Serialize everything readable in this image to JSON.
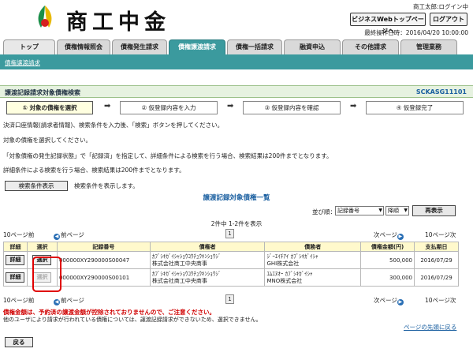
{
  "header": {
    "logo_text": "商工中金",
    "user_text": "商工太郎:ログイン中",
    "biz_top_label": "ビジネスWebトップページへ",
    "logout_label": "ログアウト",
    "last_operation": "最終操作日時：2016/04/20 10:00:00"
  },
  "tabs": [
    {
      "label": "トップ"
    },
    {
      "label": "債権情報照会"
    },
    {
      "label": "債権発生請求"
    },
    {
      "label": "債権譲渡請求"
    },
    {
      "label": "債権一括請求"
    },
    {
      "label": "融資申込"
    },
    {
      "label": "その他請求"
    },
    {
      "label": "管理業務"
    }
  ],
  "subnav": {
    "link": "債権譲渡請求"
  },
  "page": {
    "title": "譲渡記録請求対象債権検索",
    "screen_code": "SCKASG11101"
  },
  "steps": [
    {
      "label": "① 対象の債権を選択"
    },
    {
      "label": "② 仮登録内容を入力"
    },
    {
      "label": "③ 仮登録内容を確認"
    },
    {
      "label": "④ 仮登録完了"
    }
  ],
  "arrow_glyph": "➡",
  "messages": [
    "決済口座情報(請求者情報)、検索条件を入力後、「検索」ボタンを押してください。",
    "対象の債権を選択してください。",
    "「対象債権の発生記録状態」で「記録済」を指定して、詳細条件による検索を行う場合、検索結果は200件までとなります。",
    "詳細条件による検索を行う場合、検索結果は200件までとなります。"
  ],
  "search_cond": {
    "button_label": "検索条件表示",
    "note": "検索条件を表示します。"
  },
  "list": {
    "title": "譲渡記録対象債権一覧",
    "sort_label": "並び順：",
    "sort_field": "記録番号",
    "sort_order": "降順",
    "rearrange_label": "再表示",
    "count_text": "2件中 1-2件を表示",
    "prev10": "10ページ前",
    "prev": "前ページ",
    "page_num": "1",
    "next": "次ページ",
    "next10": "10ページ次"
  },
  "table": {
    "headers": [
      "詳細",
      "選択",
      "記録番号",
      "債権者",
      "債務者",
      "債権金額(円)",
      "支払期日"
    ],
    "detail_label": "詳細",
    "select_label": "選択",
    "rows": [
      {
        "record_no": "000000XY290000S00047",
        "creditor_kana": "ｶﾌﾞｼｷｶﾞｲｼｬｼｮｳｺｳﾁｭｳｷﾝｼｮｳｼﾞ",
        "creditor": "株式会社商工中央商事",
        "debtor_kana": "ｼﾞｰｴｲﾁｱｲ ｶﾌﾞｼｷｶﾞｲｼｬ",
        "debtor": "GHI株式会社",
        "amount": "500,000",
        "due_date": "2016/07/29"
      },
      {
        "record_no": "000000XY290000S00101",
        "creditor_kana": "ｶﾌﾞｼｷｶﾞｲｼｬｼｮｳｺｳﾁｭｳｷﾝｼｮｳｼﾞ",
        "creditor": "株式会社商工中央商事",
        "debtor_kana": "ｴﾑｴﾇｵｰ ｶﾌﾞｼｷｶﾞｲｼｬ",
        "debtor": "MNO株式会社",
        "amount": "300,000",
        "due_date": "2016/07/29"
      }
    ]
  },
  "warnings": {
    "red": "債権金額は、予約済の譲渡金額が控除されておりませんので、ご注意ください。",
    "note": "他のユーザにより請求が行われている債権については、譲渡記録請求ができないため、選択できません。"
  },
  "page_top": "ページの先頭に戻る",
  "back_label": "戻る",
  "colors": {
    "accent": "#3b9a9e",
    "title_bg": "#e6f2e0",
    "warn": "#d00000",
    "highlight": "#e00000"
  }
}
